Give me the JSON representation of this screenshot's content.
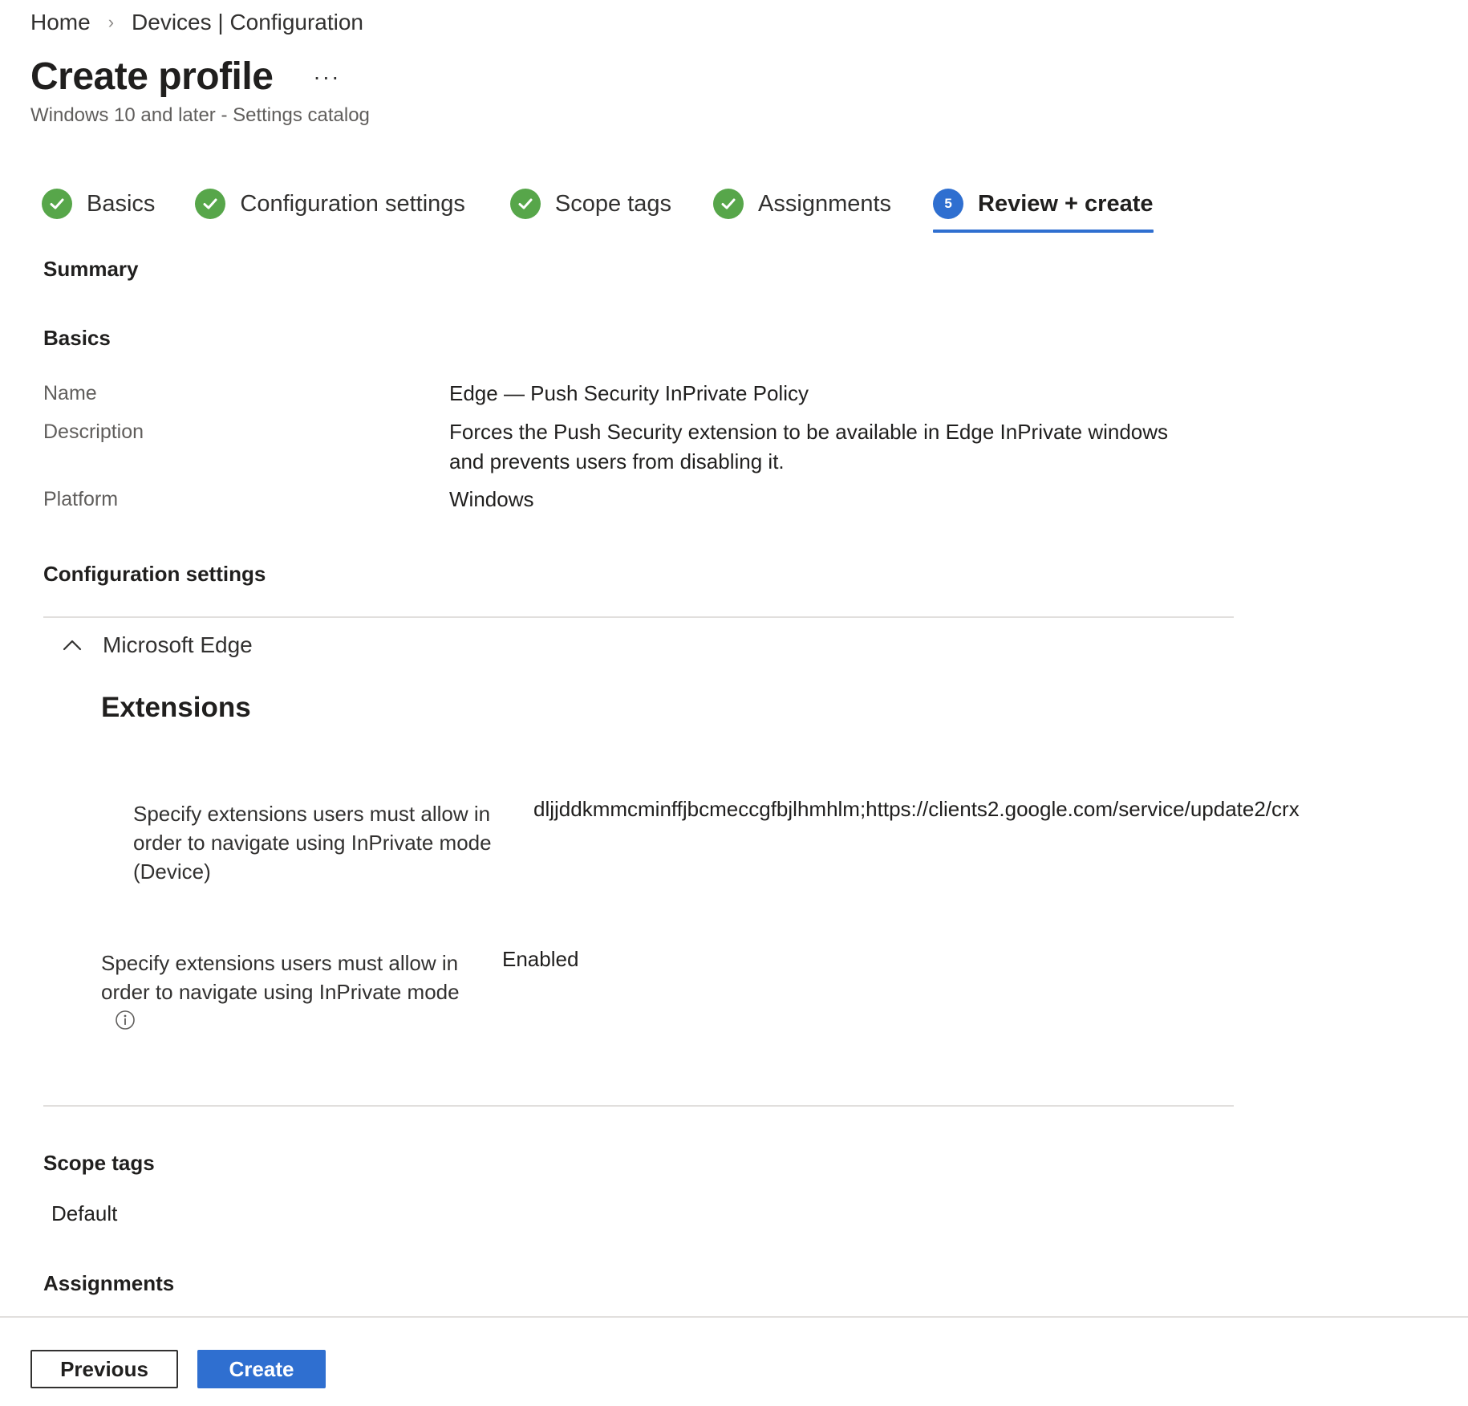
{
  "breadcrumb": {
    "home": "Home",
    "current": "Devices | Configuration"
  },
  "header": {
    "title": "Create profile",
    "more": "···",
    "subtitle": "Windows 10 and later - Settings catalog"
  },
  "steps": [
    {
      "label": "Basics",
      "status": "done"
    },
    {
      "label": "Configuration settings",
      "status": "done"
    },
    {
      "label": "Scope tags",
      "status": "done"
    },
    {
      "label": "Assignments",
      "status": "done"
    },
    {
      "label": "Review + create",
      "status": "current",
      "number": "5"
    }
  ],
  "summary": {
    "heading": "Summary"
  },
  "basics": {
    "heading": "Basics",
    "name_label": "Name",
    "name_value": "Edge — Push Security InPrivate Policy",
    "description_label": "Description",
    "description_value_line1": "Forces the Push Security extension to be available in Edge InPrivate windows",
    "description_value_line2": "and prevents users from disabling it.",
    "platform_label": "Platform",
    "platform_value": "Windows"
  },
  "configuration": {
    "heading": "Configuration settings",
    "group": "Microsoft Edge",
    "category": "Extensions",
    "device_setting": {
      "label_line1": "Specify extensions users must allow in",
      "label_line2": "order to navigate using InPrivate mode",
      "label_line3": "(Device)",
      "value": "dljjddkmmcminffjbcmeccgfbjlhmhlm;https://clients2.google.com/service/update2/crx"
    },
    "setting": {
      "label_line1": "Specify extensions users must allow in",
      "label_line2": "order to navigate using InPrivate mode",
      "value": "Enabled"
    }
  },
  "scope_tags": {
    "heading": "Scope tags",
    "value": "Default"
  },
  "assignments": {
    "heading": "Assignments"
  },
  "footer": {
    "previous_label": "Previous",
    "create_label": "Create"
  },
  "colors": {
    "accent": "#2f6fd0",
    "success": "#57a64a"
  }
}
